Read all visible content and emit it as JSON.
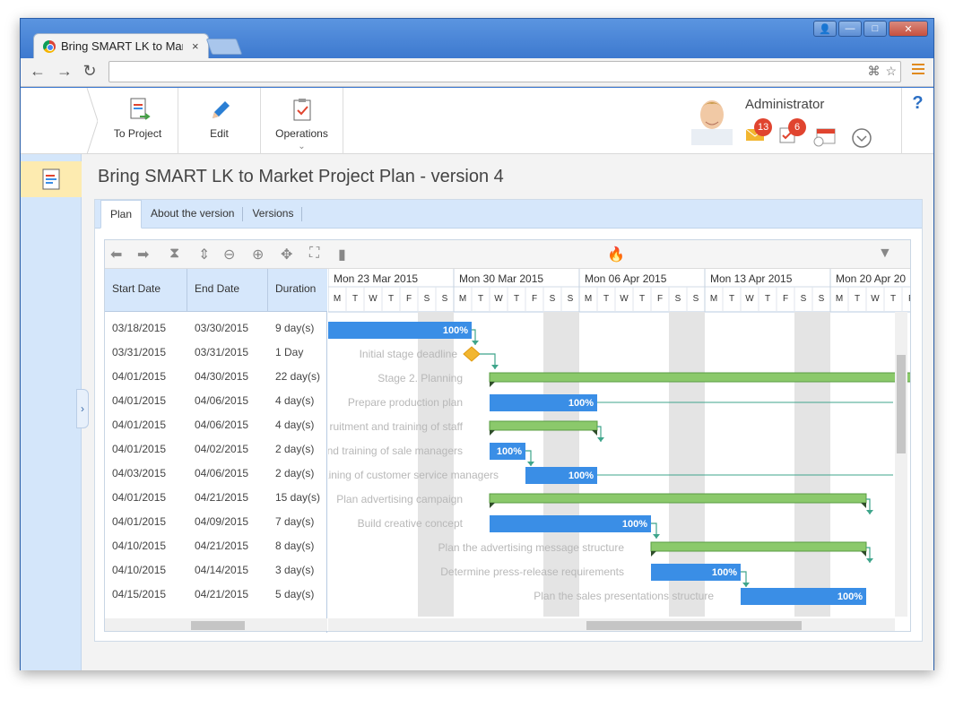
{
  "browser": {
    "tab_title": "Bring SMART LK to Marke",
    "tab_close": "×",
    "address_value": "",
    "win_buttons": {
      "user": "👤",
      "min": "—",
      "max": "□",
      "close": "✕"
    }
  },
  "toolbar": {
    "to_project_label": "To Project",
    "edit_label": "Edit",
    "operations_label": "Operations"
  },
  "user": {
    "name": "Administrator",
    "mail_count": "13",
    "tasks_count": "6",
    "help_label": "?"
  },
  "page": {
    "title": "Bring SMART LK to Market Project Plan - version 4"
  },
  "tabs": [
    {
      "label": "Plan"
    },
    {
      "label": "About the version"
    },
    {
      "label": "Versions"
    }
  ],
  "gantt": {
    "columns": [
      "Start Date",
      "End Date",
      "Duration"
    ],
    "weeks": [
      "Mon 23 Mar 2015",
      "Mon 30 Mar 2015",
      "Mon 06 Apr 2015",
      "Mon 13 Apr 2015",
      "Mon 20 Apr 20"
    ],
    "day_letters": [
      "M",
      "T",
      "W",
      "T",
      "F",
      "S",
      "S"
    ],
    "rows": [
      {
        "start": "03/18/2015",
        "end": "03/30/2015",
        "duration": "9 day(s)",
        "label": "",
        "type": "task",
        "progress": "100%"
      },
      {
        "start": "03/31/2015",
        "end": "03/31/2015",
        "duration": "1 Day",
        "label": "Initial stage deadline",
        "type": "milestone",
        "progress": ""
      },
      {
        "start": "04/01/2015",
        "end": "04/30/2015",
        "duration": "22 day(s)",
        "label": "Stage 2. Planning",
        "type": "summary",
        "progress": ""
      },
      {
        "start": "04/01/2015",
        "end": "04/06/2015",
        "duration": "4 day(s)",
        "label": "Prepare production plan",
        "type": "task",
        "progress": "100%"
      },
      {
        "start": "04/01/2015",
        "end": "04/06/2015",
        "duration": "4 day(s)",
        "label": "ruitment and training of staff",
        "type": "summary",
        "progress": ""
      },
      {
        "start": "04/01/2015",
        "end": "04/02/2015",
        "duration": "2 day(s)",
        "label": "and training of sale managers",
        "type": "task",
        "progress": "100%"
      },
      {
        "start": "04/03/2015",
        "end": "04/06/2015",
        "duration": "2 day(s)",
        "label": "raining of customer service managers",
        "type": "task",
        "progress": "100%"
      },
      {
        "start": "04/01/2015",
        "end": "04/21/2015",
        "duration": "15 day(s)",
        "label": "Plan advertising campaign",
        "type": "summary",
        "progress": ""
      },
      {
        "start": "04/01/2015",
        "end": "04/09/2015",
        "duration": "7 day(s)",
        "label": "Build creative concept",
        "type": "task",
        "progress": "100%"
      },
      {
        "start": "04/10/2015",
        "end": "04/21/2015",
        "duration": "8 day(s)",
        "label": "Plan the advertising message structure",
        "type": "summary",
        "progress": ""
      },
      {
        "start": "04/10/2015",
        "end": "04/14/2015",
        "duration": "3 day(s)",
        "label": "Determine press-release requirements",
        "type": "task",
        "progress": "100%"
      },
      {
        "start": "04/15/2015",
        "end": "04/21/2015",
        "duration": "5 day(s)",
        "label": "Plan the sales presentations structure",
        "type": "task",
        "progress": "100%"
      }
    ]
  },
  "colors": {
    "task": "#3a8ee6",
    "summary": "#8bc96b",
    "milestone": "#f2b630",
    "weekend": "#e4e4e4"
  }
}
